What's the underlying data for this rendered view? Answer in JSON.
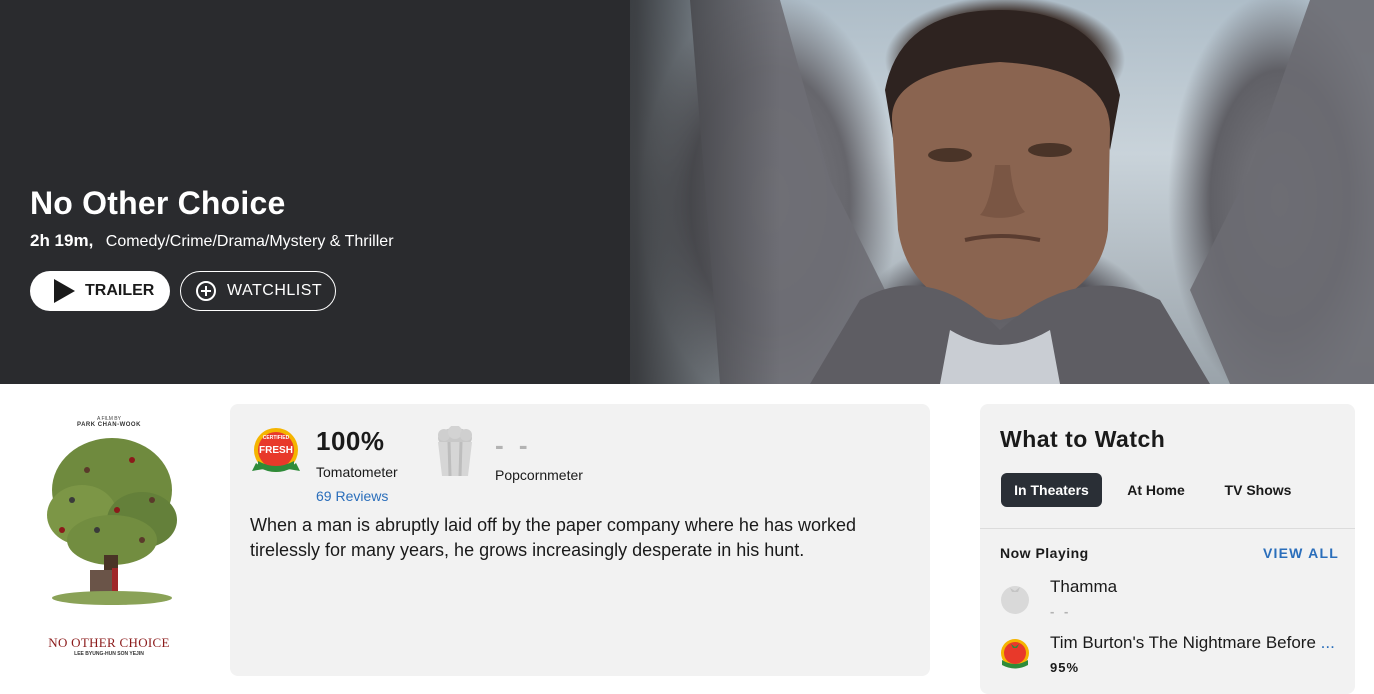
{
  "hero": {
    "title": "No Other Choice",
    "runtime": "2h 19m,",
    "genres": "Comedy/Crime/Drama/Mystery & Thriller",
    "trailer_label": "TRAILER",
    "watchlist_label": "WATCHLIST"
  },
  "poster": {
    "top_line": "A FILM BY",
    "director": "PARK CHAN-WOOK",
    "title": "NO OTHER CHOICE",
    "cast": "LEE BYUNG-HUN   SON YEJIN"
  },
  "scores": {
    "tomatometer_value": "100%",
    "tomatometer_label": "Tomatometer",
    "reviews_link": "69 Reviews",
    "popcornmeter_value": "- -",
    "popcornmeter_label": "Popcornmeter",
    "badge_text": "FRESH"
  },
  "synopsis": "When a man is abruptly laid off by the paper company where he has worked tirelessly for many years, he grows increasingly desperate in his hunt.",
  "what_to_watch": {
    "title": "What to Watch",
    "tabs": [
      {
        "label": "In Theaters",
        "active": true
      },
      {
        "label": "At Home",
        "active": false
      },
      {
        "label": "TV Shows",
        "active": false
      }
    ],
    "section_label": "Now Playing",
    "view_all": "VIEW ALL",
    "movies": [
      {
        "title": "Thamma",
        "score": "- -",
        "icon": "empty-tomato-icon"
      },
      {
        "title": "Tim Burton's The Nightmare Before ",
        "ellipsis": "...",
        "score": "95%",
        "icon": "certified-fresh-icon"
      }
    ]
  },
  "colors": {
    "hero_bg": "#2a2b2e",
    "panel_bg": "#f2f2f2",
    "link_blue": "#2a6ebb",
    "tab_active": "#2a2f36",
    "poster_title": "#8b1a1a"
  }
}
